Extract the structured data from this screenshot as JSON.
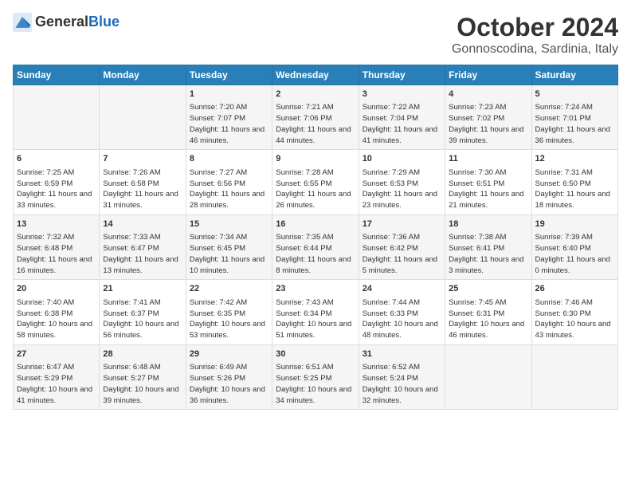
{
  "logo": {
    "text_general": "General",
    "text_blue": "Blue"
  },
  "header": {
    "month": "October 2024",
    "location": "Gonnoscodina, Sardinia, Italy"
  },
  "days_of_week": [
    "Sunday",
    "Monday",
    "Tuesday",
    "Wednesday",
    "Thursday",
    "Friday",
    "Saturday"
  ],
  "weeks": [
    [
      {
        "day": "",
        "content": ""
      },
      {
        "day": "",
        "content": ""
      },
      {
        "day": "1",
        "content": "Sunrise: 7:20 AM\nSunset: 7:07 PM\nDaylight: 11 hours and 46 minutes."
      },
      {
        "day": "2",
        "content": "Sunrise: 7:21 AM\nSunset: 7:06 PM\nDaylight: 11 hours and 44 minutes."
      },
      {
        "day": "3",
        "content": "Sunrise: 7:22 AM\nSunset: 7:04 PM\nDaylight: 11 hours and 41 minutes."
      },
      {
        "day": "4",
        "content": "Sunrise: 7:23 AM\nSunset: 7:02 PM\nDaylight: 11 hours and 39 minutes."
      },
      {
        "day": "5",
        "content": "Sunrise: 7:24 AM\nSunset: 7:01 PM\nDaylight: 11 hours and 36 minutes."
      }
    ],
    [
      {
        "day": "6",
        "content": "Sunrise: 7:25 AM\nSunset: 6:59 PM\nDaylight: 11 hours and 33 minutes."
      },
      {
        "day": "7",
        "content": "Sunrise: 7:26 AM\nSunset: 6:58 PM\nDaylight: 11 hours and 31 minutes."
      },
      {
        "day": "8",
        "content": "Sunrise: 7:27 AM\nSunset: 6:56 PM\nDaylight: 11 hours and 28 minutes."
      },
      {
        "day": "9",
        "content": "Sunrise: 7:28 AM\nSunset: 6:55 PM\nDaylight: 11 hours and 26 minutes."
      },
      {
        "day": "10",
        "content": "Sunrise: 7:29 AM\nSunset: 6:53 PM\nDaylight: 11 hours and 23 minutes."
      },
      {
        "day": "11",
        "content": "Sunrise: 7:30 AM\nSunset: 6:51 PM\nDaylight: 11 hours and 21 minutes."
      },
      {
        "day": "12",
        "content": "Sunrise: 7:31 AM\nSunset: 6:50 PM\nDaylight: 11 hours and 18 minutes."
      }
    ],
    [
      {
        "day": "13",
        "content": "Sunrise: 7:32 AM\nSunset: 6:48 PM\nDaylight: 11 hours and 16 minutes."
      },
      {
        "day": "14",
        "content": "Sunrise: 7:33 AM\nSunset: 6:47 PM\nDaylight: 11 hours and 13 minutes."
      },
      {
        "day": "15",
        "content": "Sunrise: 7:34 AM\nSunset: 6:45 PM\nDaylight: 11 hours and 10 minutes."
      },
      {
        "day": "16",
        "content": "Sunrise: 7:35 AM\nSunset: 6:44 PM\nDaylight: 11 hours and 8 minutes."
      },
      {
        "day": "17",
        "content": "Sunrise: 7:36 AM\nSunset: 6:42 PM\nDaylight: 11 hours and 5 minutes."
      },
      {
        "day": "18",
        "content": "Sunrise: 7:38 AM\nSunset: 6:41 PM\nDaylight: 11 hours and 3 minutes."
      },
      {
        "day": "19",
        "content": "Sunrise: 7:39 AM\nSunset: 6:40 PM\nDaylight: 11 hours and 0 minutes."
      }
    ],
    [
      {
        "day": "20",
        "content": "Sunrise: 7:40 AM\nSunset: 6:38 PM\nDaylight: 10 hours and 58 minutes."
      },
      {
        "day": "21",
        "content": "Sunrise: 7:41 AM\nSunset: 6:37 PM\nDaylight: 10 hours and 56 minutes."
      },
      {
        "day": "22",
        "content": "Sunrise: 7:42 AM\nSunset: 6:35 PM\nDaylight: 10 hours and 53 minutes."
      },
      {
        "day": "23",
        "content": "Sunrise: 7:43 AM\nSunset: 6:34 PM\nDaylight: 10 hours and 51 minutes."
      },
      {
        "day": "24",
        "content": "Sunrise: 7:44 AM\nSunset: 6:33 PM\nDaylight: 10 hours and 48 minutes."
      },
      {
        "day": "25",
        "content": "Sunrise: 7:45 AM\nSunset: 6:31 PM\nDaylight: 10 hours and 46 minutes."
      },
      {
        "day": "26",
        "content": "Sunrise: 7:46 AM\nSunset: 6:30 PM\nDaylight: 10 hours and 43 minutes."
      }
    ],
    [
      {
        "day": "27",
        "content": "Sunrise: 6:47 AM\nSunset: 5:29 PM\nDaylight: 10 hours and 41 minutes."
      },
      {
        "day": "28",
        "content": "Sunrise: 6:48 AM\nSunset: 5:27 PM\nDaylight: 10 hours and 39 minutes."
      },
      {
        "day": "29",
        "content": "Sunrise: 6:49 AM\nSunset: 5:26 PM\nDaylight: 10 hours and 36 minutes."
      },
      {
        "day": "30",
        "content": "Sunrise: 6:51 AM\nSunset: 5:25 PM\nDaylight: 10 hours and 34 minutes."
      },
      {
        "day": "31",
        "content": "Sunrise: 6:52 AM\nSunset: 5:24 PM\nDaylight: 10 hours and 32 minutes."
      },
      {
        "day": "",
        "content": ""
      },
      {
        "day": "",
        "content": ""
      }
    ]
  ]
}
